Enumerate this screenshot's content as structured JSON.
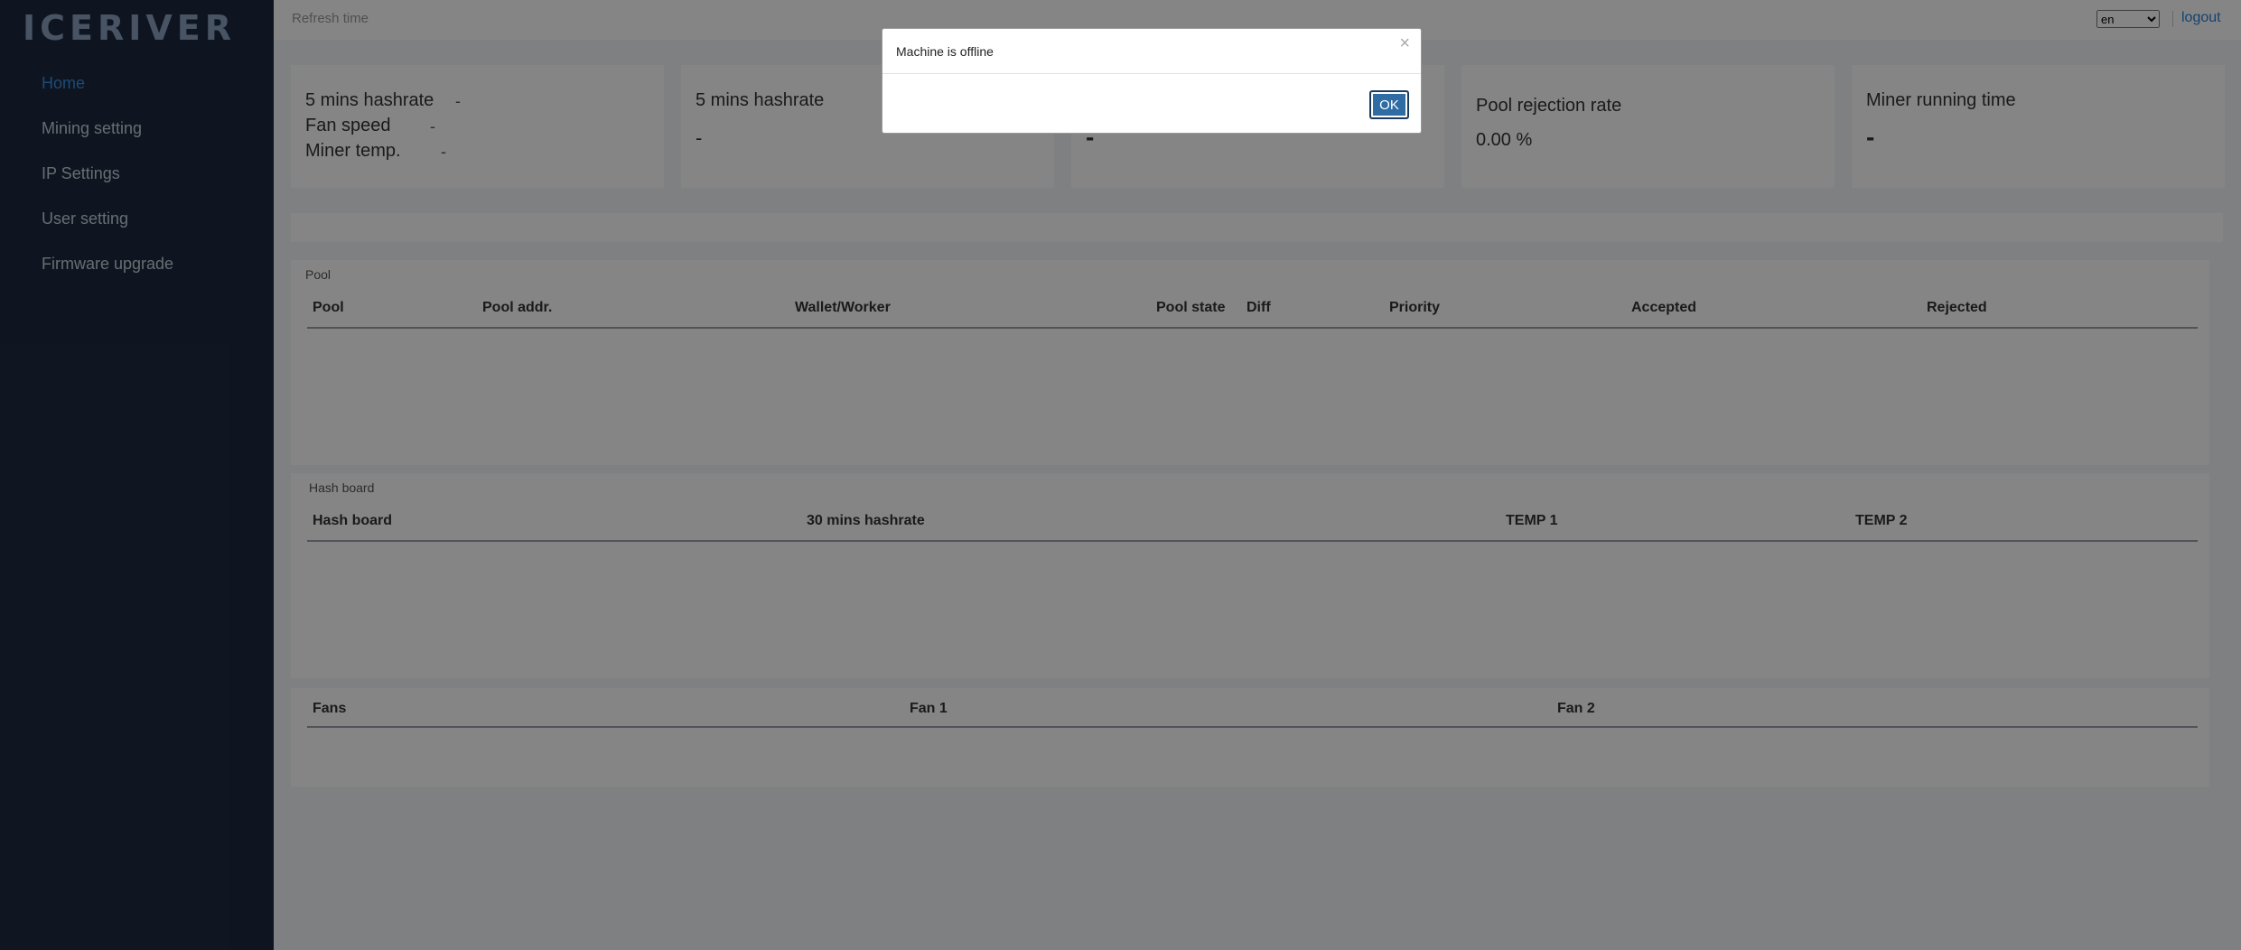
{
  "logo": "ICERIVER",
  "sidebar": {
    "items": [
      {
        "label": "Home",
        "active": true
      },
      {
        "label": "Mining setting"
      },
      {
        "label": "IP Settings"
      },
      {
        "label": "User setting"
      },
      {
        "label": "Firmware upgrade"
      }
    ]
  },
  "topbar": {
    "refresh_label": "Refresh time",
    "language": "en",
    "logout_label": "logout"
  },
  "cards": {
    "summary": {
      "hashrate_label": "5 mins hashrate",
      "hashrate_value": "-",
      "fan_label": "Fan speed",
      "fan_value": "-",
      "temp_label": "Miner temp.",
      "temp_value": "-"
    },
    "hashrate": {
      "title": "5 mins hashrate",
      "value": "-"
    },
    "third": {
      "value": "-"
    },
    "rejection": {
      "title": "Pool rejection rate",
      "value": "0.00 %"
    },
    "runtime": {
      "title": "Miner running time",
      "value": "-"
    }
  },
  "pool": {
    "title": "Pool",
    "columns": [
      "Pool",
      "Pool addr.",
      "Wallet/Worker",
      "Pool state",
      "Diff",
      "Priority",
      "Accepted",
      "Rejected"
    ],
    "rows": []
  },
  "hashboard": {
    "title": "Hash board",
    "columns": [
      "Hash board",
      "30 mins hashrate",
      "TEMP 1",
      "TEMP 2"
    ],
    "rows": []
  },
  "fans": {
    "columns": [
      "Fans",
      "Fan 1",
      "Fan 2"
    ],
    "rows": []
  },
  "modal": {
    "message": "Machine is offline",
    "close_glyph": "×",
    "ok_label": "OK"
  },
  "colors": {
    "sidebar": "#1c2a3f",
    "accent": "#3a8fe0",
    "ok_button": "#2f6ca3"
  }
}
